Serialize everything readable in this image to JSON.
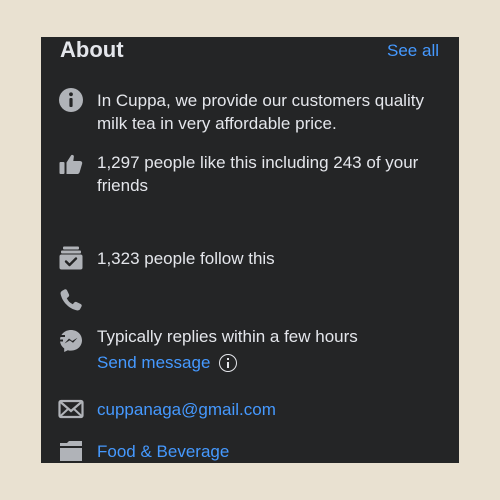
{
  "header": {
    "title": "About",
    "see_all_label": "See all"
  },
  "items": {
    "description": "In Cuppa, we provide our customers quality milk tea in very affordable price.",
    "likes": "1,297 people like this including 243 of your friends",
    "follows": "1,323 people follow this",
    "reply_time": "Typically replies within a few hours",
    "send_message_label": "Send message",
    "email": "cuppanaga@gmail.com",
    "category": "Food & Beverage"
  },
  "colors": {
    "background": "#e9e1d1",
    "panel": "#242526",
    "text": "#e4e6eb",
    "icon": "#b0b3b8",
    "link": "#4599ff"
  },
  "icons": [
    "info-icon",
    "thumbs-up-icon",
    "follow-icon",
    "phone-icon",
    "messenger-icon",
    "email-icon",
    "category-icon"
  ]
}
